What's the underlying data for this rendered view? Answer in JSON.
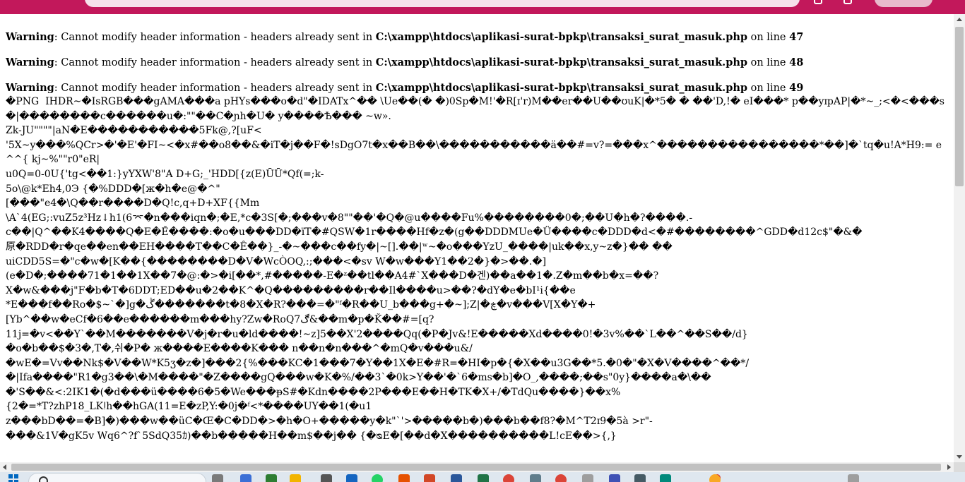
{
  "warnings": [
    {
      "prefix": "Warning",
      "message": ": Cannot modify header information - headers already sent in ",
      "file": "C:\\xampp\\htdocs\\aplikasi-surat-bpkp\\transaksi_surat_masuk.php",
      "on_line": " on line ",
      "line": "47"
    },
    {
      "prefix": "Warning",
      "message": ": Cannot modify header information - headers already sent in ",
      "file": "C:\\xampp\\htdocs\\aplikasi-surat-bpkp\\transaksi_surat_masuk.php",
      "on_line": " on line ",
      "line": "48"
    },
    {
      "prefix": "Warning",
      "message": ": Cannot modify header information - headers already sent in ",
      "file": "C:\\xampp\\htdocs\\aplikasi-surat-bpkp\\transaksi_surat_masuk.php",
      "on_line": " on line ",
      "line": "49"
    }
  ],
  "binary_output": "�PNG  IHDR~�IsRGB���gAMA���a pHYs���o�d\"�IDATx^�� \\Ue��(� �)0Sp�M!'�R[ɪ'r)M��er��U��ʊuK|�*5� � ��'D,!� eI���* p��yɪpAP|�*~_;<�<���s�|��������c������u�:\"\"��C�ɲh�U� y����Ѣ��� ~w».\nZk-JU\"\"\"\"|aN�E�����������5Fk@,?[uF<\n'5X~y���%QCr>�'�E'�FI~<�x#��o8��&�iT�j��F�!sDgO7t�x��B��\\�����������ä��#=v?=���x^����������������*��]�`tq�u!A*H9:= e ^^{ kj~%\"\"r0\"eR|\nu0Q=0-0U{'tg<��1:}yYXW'8\"A D+G;_'HDD[{z(E)ŪŪ*Qf(=;k-\n5o\\@k*Eh4,0Э {�%DDD�[ж�h�e@�^\"\n[���\"e4�\\Q��r����D�Q!c,q+D+XF{{Mm\n\\A`4(EG;:vuZ5z³Hz↓h1(6⌤�n���iqn�;�E,*c�3S[�;���v�8\"\"��'�Q�@u����Fu%��������0�;��U�h�?����.-\nc��|Q^��K4����Q�E�Ě����:�o�u���DD�ïT�#QSW�1r����Hf�z�(g��DDDMUe�Ü����c�DDD�d<�#��������^GDD�d12c$\"�&�\n原�RDD�r�qe��en��EH����T��C�Ê��}_-�~���c��fy�|~[].��|ʷ~�o���YzU_����|uk��x,y~z�}�� ��\nuiCDD5S=�\"c�w�[K��{��������D�V�WcÒOQ,:;���<�sv W�w���Y1��2�}�>��.�]\n(e�D�;����71�1��1X��7�@:�>�i[��*,#�����-E�ᶻ��tl��A4#`X���D�겐)��a��1�.Z�m��b�x=��?\nX�w&���j\"F�b�T�6DDT;ED��u�2��K^�Q���������r��Il����u>��?�dY�e�bI¹i{��e\n*E���f��Ro�$~`�]g�ڴ�������t�8�X�R?���=�\"ᶠ�R��U_b���g+�~];Z|�ڿ�v���V[X�Y�+\n[Yb^��w�eCf�6��e������m���hy?Zw�RoQ7ڰ&��m�p�Ǩ��#=[q?\n11j=�v<��Y`��M�������V�j�r�u�ld����!~z]5��X'2����Qq(�P�Jv&!E�����Xd����0!�3v%��`L��^��S��/d}\n�o�b��$�3�,T�,쉬�P� ж����E����K��� n��n�n���^�mQ�v���u&/\n�wE�=Vv��Nk$�V��W*K5ʒ�z�]���2{%���KC�1���7�Y��1X�E�#R=�HI�p�{�X��u3G��*5.�0�\"�X�V����^��*/\n�|Ifa����\"R1�g3��\\�M����\"�Z����gQ���w�K�%/��3`�0k>Y��'�`6�ms�b]�O_,����;��s\"0y}����a�\\��\n�'S��&<:2IK1�(�d���ü����6�5�We���ᵽS#�Kdn����2P���E��H�TK�X+/�TdQu����}��x%\n{2�=*T?zhP18_LKǃh��hGA(11=E�zP,Y:�0j�ᶠ<*����UY��1(�u1\nz���bD��=�B]�)���w��üC�Œ�C�DD�>�h�O+�����y�k\"`'>�����b�)���b��f8?�M^T2ɪ9�5à >r\"-\n���&1V�gK5v Wq6^?f`5SdQ35ｶ)��b�����H��m$��j�� {�ᴓE�[��d�X����������L!cE��>{,}"
}
